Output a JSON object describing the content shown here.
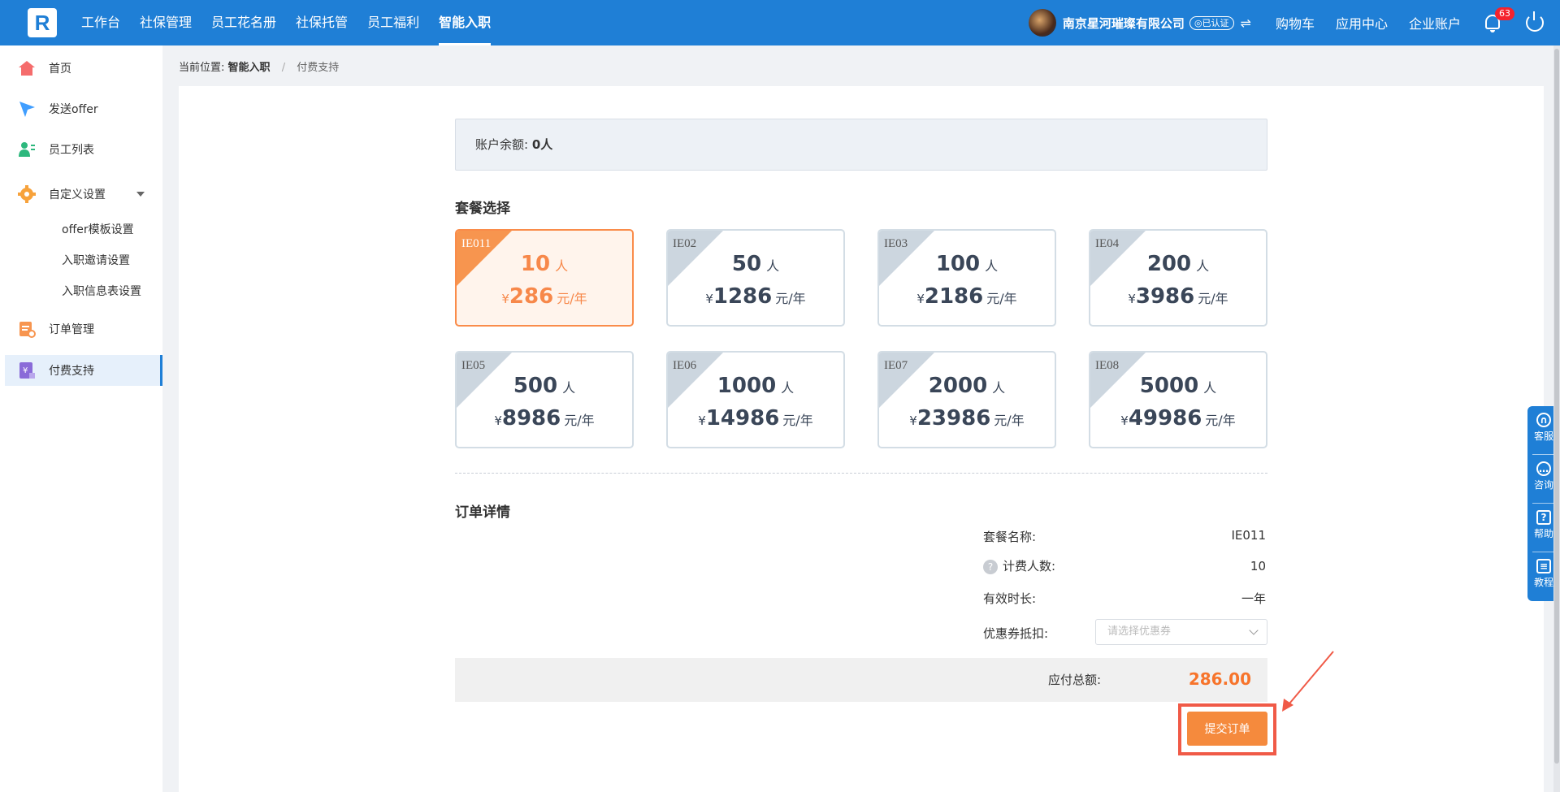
{
  "topbar": {
    "logo": "R",
    "nav": [
      "工作台",
      "社保管理",
      "员工花名册",
      "社保托管",
      "员工福利",
      "智能入职"
    ],
    "company": "南京星河璀璨有限公司",
    "cert": "◎已认证",
    "switch_icon": "⇌",
    "links": [
      "购物车",
      "应用中心",
      "企业账户"
    ],
    "notification_count": "63"
  },
  "sidebar": {
    "items": [
      {
        "label": "首页",
        "icon": "home-icon",
        "color": "#f56c6c"
      },
      {
        "label": "发送offer",
        "icon": "send-icon",
        "color": "#409eff"
      },
      {
        "label": "员工列表",
        "icon": "users-icon",
        "color": "#2db87d"
      },
      {
        "label": "自定义设置",
        "icon": "gear-icon",
        "color": "#f7a23b"
      },
      {
        "label": "订单管理",
        "icon": "order-icon",
        "color": "#f7954f"
      },
      {
        "label": "付费支持",
        "icon": "payment-icon",
        "color": "#8a6bd8"
      }
    ],
    "sub_items": [
      "offer模板设置",
      "入职邀请设置",
      "入职信息表设置"
    ]
  },
  "breadcrumb": {
    "prefix": "当前位置:",
    "parent": "智能入职",
    "sep": "/",
    "current": "付费支持"
  },
  "balance": {
    "label": "账户余额:",
    "value": "0人"
  },
  "packages_title": "套餐选择",
  "packages": [
    {
      "code": "IE011",
      "people": "10",
      "price": "286",
      "selected": true
    },
    {
      "code": "IE02",
      "people": "50",
      "price": "1286"
    },
    {
      "code": "IE03",
      "people": "100",
      "price": "2186"
    },
    {
      "code": "IE04",
      "people": "200",
      "price": "3986"
    },
    {
      "code": "IE05",
      "people": "500",
      "price": "8986"
    },
    {
      "code": "IE06",
      "people": "1000",
      "price": "14986"
    },
    {
      "code": "IE07",
      "people": "2000",
      "price": "23986"
    },
    {
      "code": "IE08",
      "people": "5000",
      "price": "49986"
    }
  ],
  "units": {
    "people": "人",
    "yen": "¥",
    "per_year": "元/年"
  },
  "order": {
    "title": "订单详情",
    "name_label": "套餐名称:",
    "name_value": "IE011",
    "count_label": "计费人数:",
    "count_value": "10",
    "duration_label": "有效时长:",
    "duration_value": "一年",
    "coupon_label": "优惠券抵扣:",
    "coupon_placeholder": "请选择优惠券",
    "total_label": "应付总额:",
    "total_value": "286.00",
    "submit": "提交订单"
  },
  "float_panel": [
    "客服",
    "咨询",
    "帮助",
    "教程"
  ],
  "colors": {
    "primary": "#1f7fd6",
    "accent": "#f7884a",
    "total": "#f7742b",
    "highlight": "#f05a47"
  }
}
